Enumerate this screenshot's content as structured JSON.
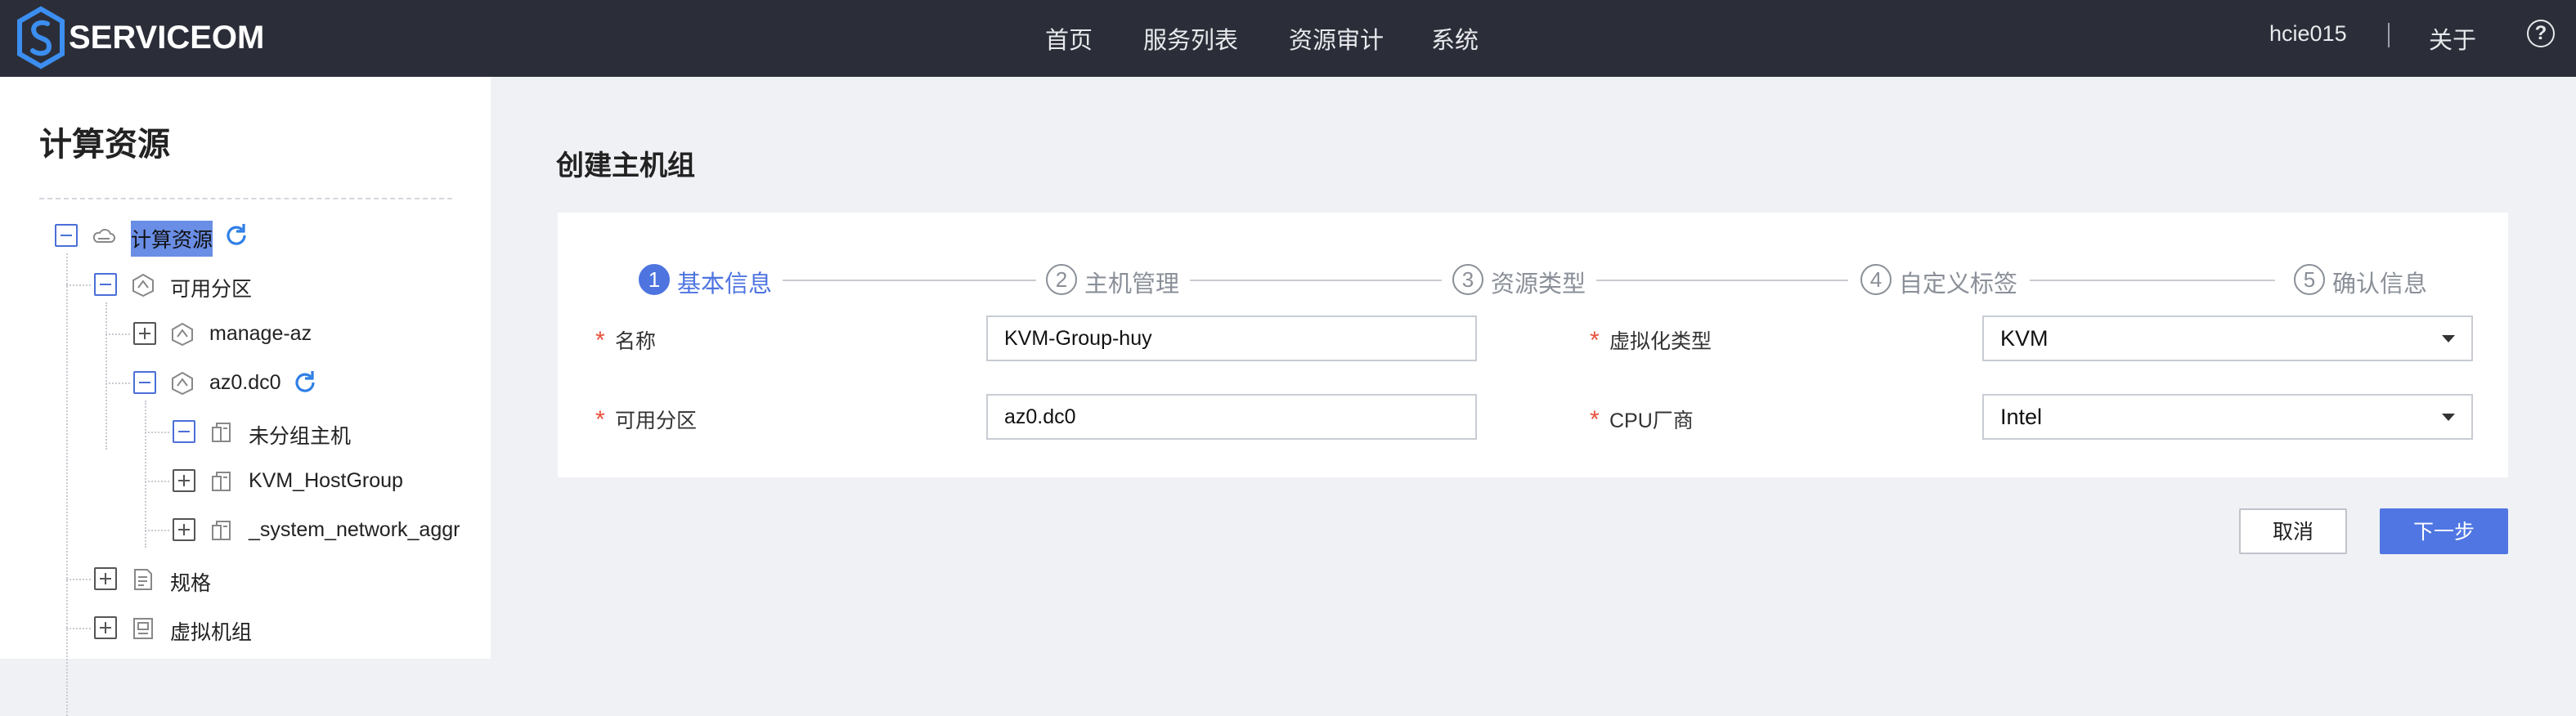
{
  "header": {
    "logo_text": "SERVICEOM",
    "nav": [
      "首页",
      "服务列表",
      "资源审计",
      "系统"
    ],
    "user": "hcie015",
    "about": "关于",
    "help": "?"
  },
  "sidebar": {
    "title": "计算资源",
    "tree": [
      {
        "label": "计算资源",
        "toggle": "minus",
        "icon": "cloud-icon",
        "selected": true,
        "refresh": true
      },
      {
        "label": "可用分区",
        "toggle": "minus",
        "icon": "hexagon-icon"
      },
      {
        "label": "manage-az",
        "toggle": "plus",
        "icon": "hexagon-icon"
      },
      {
        "label": "az0.dc0",
        "toggle": "minus",
        "icon": "hexagon-icon",
        "refresh": true
      },
      {
        "label": "未分组主机",
        "toggle": "minus",
        "icon": "host-group-icon"
      },
      {
        "label": "KVM_HostGroup",
        "toggle": "plus",
        "icon": "host-group-icon"
      },
      {
        "label": "_system_network_aggr",
        "toggle": "plus",
        "icon": "host-group-icon"
      },
      {
        "label": "规格",
        "toggle": "plus",
        "icon": "document-icon"
      },
      {
        "label": "虚拟机组",
        "toggle": "plus",
        "icon": "vm-group-icon"
      }
    ]
  },
  "main": {
    "title": "创建主机组",
    "steps": [
      {
        "num": "1",
        "label": "基本信息",
        "active": true
      },
      {
        "num": "2",
        "label": "主机管理",
        "active": false
      },
      {
        "num": "3",
        "label": "资源类型",
        "active": false
      },
      {
        "num": "4",
        "label": "自定义标签",
        "active": false
      },
      {
        "num": "5",
        "label": "确认信息",
        "active": false
      }
    ],
    "form": {
      "required_mark": "*",
      "name_label": "名称",
      "name_value": "KVM-Group-huy",
      "az_label": "可用分区",
      "az_value": "az0.dc0",
      "virt_label": "虚拟化类型",
      "virt_value": "KVM",
      "cpu_label": "CPU厂商",
      "cpu_value": "Intel"
    },
    "buttons": {
      "cancel": "取消",
      "next": "下一步"
    }
  },
  "colors": {
    "accent": "#4e74e0",
    "topbar": "#2b2e38",
    "required": "#e8503a",
    "selection": "#6a8ee5"
  }
}
